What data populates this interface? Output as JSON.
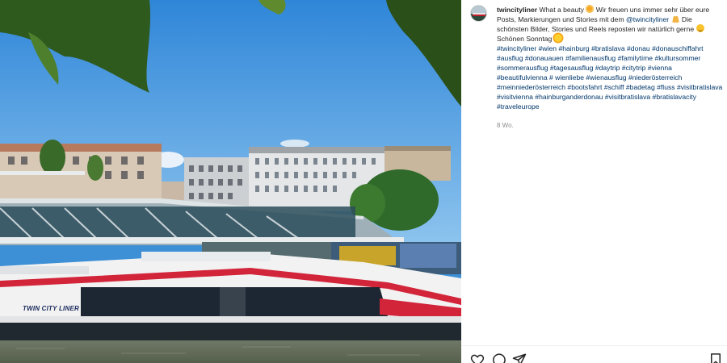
{
  "post": {
    "username": "twincityliner",
    "caption_parts": [
      {
        "type": "text",
        "value": "What a beauty "
      },
      {
        "type": "emoji",
        "icon": "star-struck-emoji"
      },
      {
        "type": "text",
        "value": " Wir freuen uns immer sehr über eure Posts, Markierungen und Stories mit dem "
      },
      {
        "type": "mention",
        "value": "@twincityliner"
      },
      {
        "type": "text",
        "value": " "
      },
      {
        "type": "emoji",
        "icon": "folded-hands-emoji"
      },
      {
        "type": "text",
        "value": " Die schönsten Bilder, Stories und Reels reposten wir natürlich gerne "
      },
      {
        "type": "emoji",
        "icon": "smiling-face-emoji"
      }
    ],
    "caption_line2": "Schönen Sonntag",
    "hashtags": [
      "#twincityliner",
      "#wien",
      "#hainburg",
      "#bratislava",
      "#donau",
      "#donauschiffahrt",
      "#ausflug",
      "#donauauen",
      "#familienausflug",
      "#familytime",
      "#kultursommer",
      "#sommerausflug",
      "#tagesausflug",
      "#daytrip",
      "#citytrip",
      "#vienna",
      "#beautifulvienna",
      "# wienliebe",
      "#wienausflug",
      "#niederösterreich",
      "#meinniederösterreich",
      "#bootsfahrt",
      "#schiff",
      "#badetag",
      "#fluss",
      "#visitbratislava",
      "#visitvienna",
      "#hainburganderdonau",
      "#visitbratislava",
      "#bratislavacity",
      "#traveleurope"
    ],
    "timestamp": "8 Wo."
  },
  "photo": {
    "boat_name": "TWIN CITY LINER",
    "colors": {
      "sky": "#3d8fd6",
      "water": "#6b7560",
      "boat_red": "#d2253a",
      "boat_white": "#f2f2f2",
      "leaf": "#2f5a1e"
    }
  },
  "actions": {
    "like_icon": "heart-icon",
    "comment_icon": "comment-icon",
    "share_icon": "send-icon",
    "save_icon": "bookmark-icon"
  },
  "colors": {
    "link": "#00376b",
    "text": "#262626",
    "muted": "#8e8e8e"
  }
}
